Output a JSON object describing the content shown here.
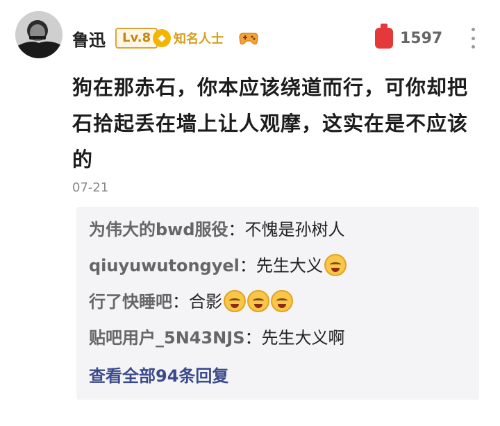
{
  "comment": {
    "username": "鲁迅",
    "level": "Lv.8",
    "title_badge": "知名人士",
    "like_count": "1597",
    "text": "狗在那赤石，你本应该绕道而行，可你却把石拾起丢在墙上让人观摩，这实在是不应该的",
    "date": "07-21"
  },
  "replies": [
    {
      "name": "为伟大的bwd服役",
      "sep": "：",
      "text": "不愧是孙树人",
      "emoji_count": 0
    },
    {
      "name": "qiuyuwutongyel",
      "sep": "：",
      "text": "先生大义",
      "emoji_count": 1
    },
    {
      "name": "行了快睡吧",
      "sep": "：",
      "text": "合影",
      "emoji_count": 3
    },
    {
      "name": "贴吧用户_5N43NJS",
      "sep": "：",
      "text": "先生大义啊",
      "emoji_count": 0
    }
  ],
  "view_all_label": "查看全部94条回复",
  "colors": {
    "like": "#e5383b",
    "level_badge": "#e0a236",
    "title_badge": "#d69e1a",
    "link": "#3b4a8c",
    "reply_bg": "#f4f4f6"
  },
  "icons": {
    "title_badge_icon": "diamond-icon",
    "game_badge_icon": "gamepad-icon",
    "like_icon": "thumbs-up-icon",
    "more_icon": "more-vertical-icon",
    "reply_emoji": "laughing-emoji-icon"
  }
}
